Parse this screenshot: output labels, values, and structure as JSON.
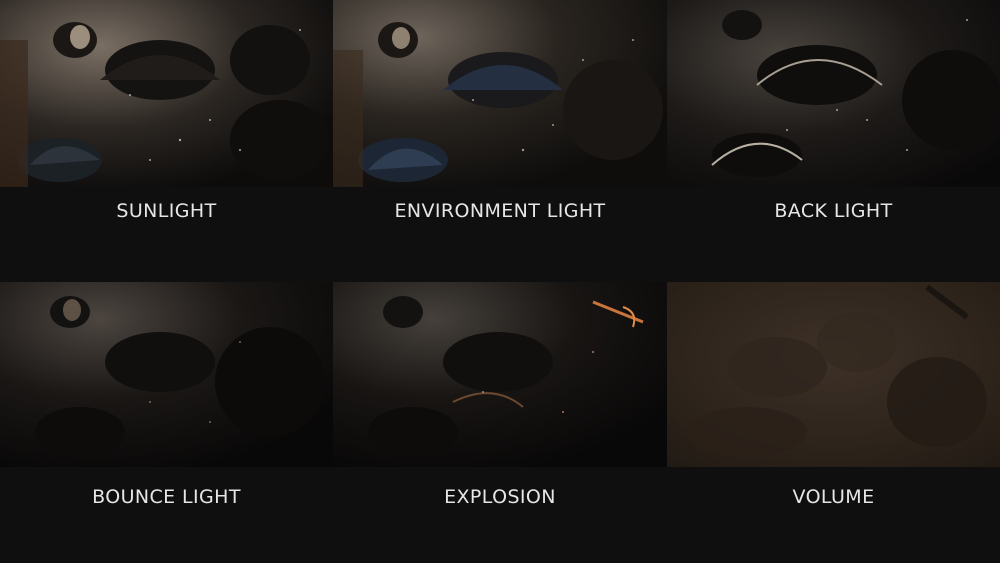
{
  "panels": [
    {
      "label": "SUNLIGHT",
      "tone": "#3a342e",
      "highlight": "#8a7d6e",
      "rim": "#c9b79d"
    },
    {
      "label": "ENVIRONMENT LIGHT",
      "tone": "#2f2a26",
      "highlight": "#6c5f52",
      "rim": "#9aa6b8"
    },
    {
      "label": "BACK LIGHT",
      "tone": "#262321",
      "highlight": "#5a534c",
      "rim": "#b6aea3"
    },
    {
      "label": "BOUNCE LIGHT",
      "tone": "#1c1917",
      "highlight": "#4a4038",
      "rim": "#7b6a58"
    },
    {
      "label": "EXPLOSION",
      "tone": "#1b1816",
      "highlight": "#5a3f2a",
      "rim": "#c8743a"
    },
    {
      "label": "VOLUME",
      "tone": "#2e2620",
      "highlight": "#4a3b2f",
      "rim": "#6a5644"
    }
  ]
}
